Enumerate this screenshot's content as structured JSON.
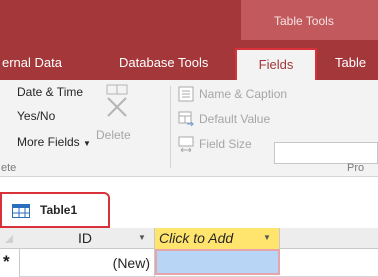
{
  "contextual_tab_group": "Table Tools",
  "ribbon_tabs": [
    "ernal Data",
    "Database Tools",
    "Fields",
    "Table"
  ],
  "active_tab": "Fields",
  "add_delete_group": {
    "items": [
      "Date & Time",
      "Yes/No",
      "More Fields"
    ],
    "delete_label": "Delete",
    "group_label": "ete"
  },
  "properties_group": {
    "items": [
      "Name & Caption",
      "Default Value",
      "Field Size"
    ],
    "group_label": "Pro"
  },
  "document_tab": "Table1",
  "datasheet": {
    "columns": [
      "ID",
      "Click to Add"
    ],
    "new_row_marker": "*",
    "new_row_value": "(New)"
  },
  "colors": {
    "ribbon_bar": "#a4373a",
    "contextual_group": "#c25a5d",
    "highlight_outline": "#d9313a",
    "click_to_add_header": "#ffe56e",
    "selected_cell": "#b8d5f5"
  }
}
